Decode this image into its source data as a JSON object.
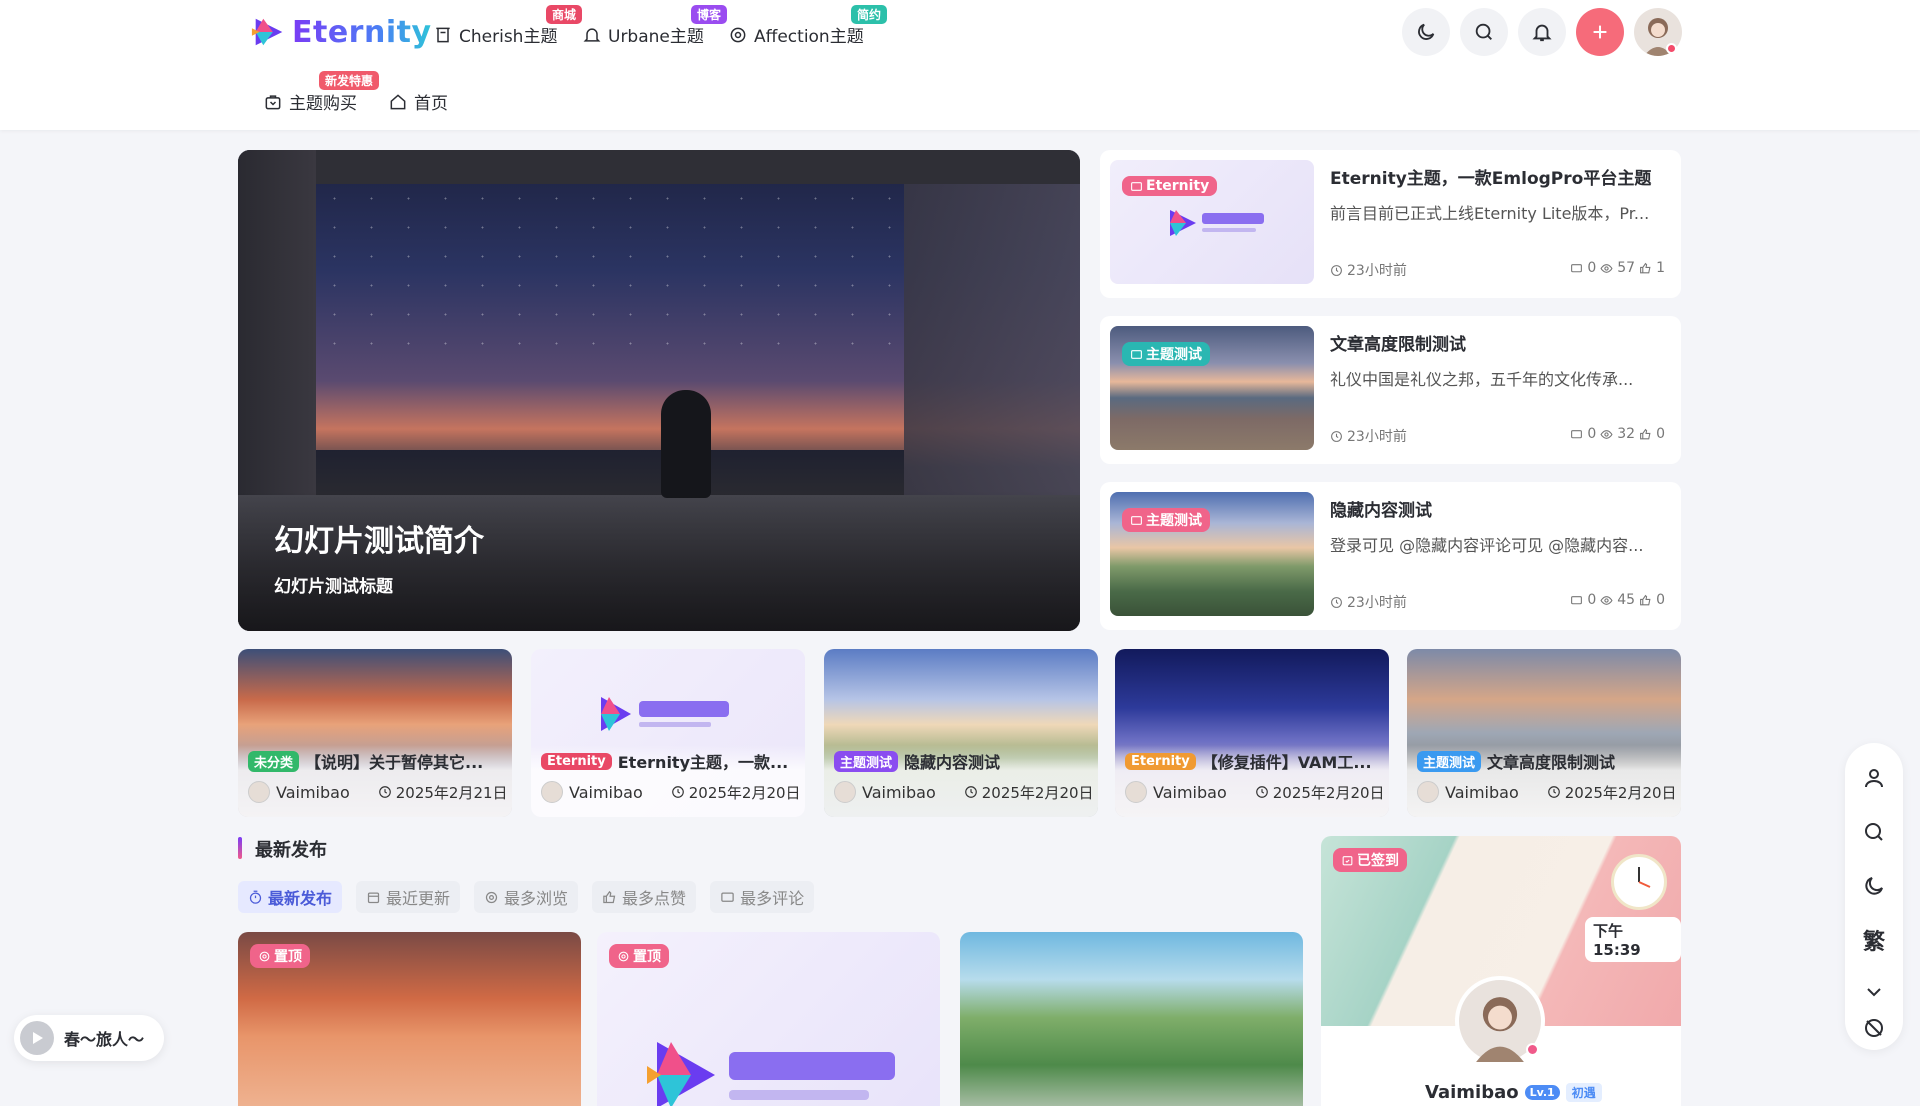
{
  "brand": {
    "name": "Eternity"
  },
  "nav": [
    {
      "label": "Cherish主题",
      "badge": "商城",
      "badge_color": "#e94866",
      "icon": "shop-icon"
    },
    {
      "label": "Urbane主题",
      "badge": "博客",
      "badge_color": "#9a4cf0",
      "icon": "bell-outline-icon"
    },
    {
      "label": "Affection主题",
      "badge": "简约",
      "badge_color": "#2cc0aa",
      "icon": "target-icon"
    },
    {
      "label": "主题购买",
      "badge": "新发特惠",
      "badge_color": "#f05a6b",
      "icon": "bag-icon"
    },
    {
      "label": "首页",
      "icon": "home-icon"
    }
  ],
  "header_actions": [
    "theme-toggle",
    "search",
    "notifications",
    "add",
    "user-avatar"
  ],
  "hero": {
    "title": "幻灯片测试简介",
    "subtitle": "幻灯片测试标题"
  },
  "side_posts": [
    {
      "tag": "Eternity",
      "tag_color": "#f0648a",
      "title": "Eternity主题，一款EmlogPro平台主题",
      "desc": "前言目前已正式上线Eternity Lite版本，Pr...",
      "time": "23小时前",
      "comments": "0",
      "views": "57",
      "likes": "1"
    },
    {
      "tag": "主题测试",
      "tag_color": "#2ab7b2",
      "title": "文章高度限制测试",
      "desc": "礼仪中国是礼仪之邦，五千年的文化传承...",
      "time": "23小时前",
      "comments": "0",
      "views": "32",
      "likes": "0"
    },
    {
      "tag": "主题测试",
      "tag_color": "#f0648a",
      "title": "隐藏内容测试",
      "desc": "登录可见 @隐藏内容评论可见 @隐藏内容...",
      "time": "23小时前",
      "comments": "0",
      "views": "45",
      "likes": "0"
    }
  ],
  "row_posts": [
    {
      "pill": "未分类",
      "pill_color": "#32b86a",
      "title": "【说明】关于暂停其它...",
      "author": "Vaimibao",
      "date": "2025年2月21日"
    },
    {
      "pill": "Eternity",
      "pill_color": "#e94866",
      "title": "Eternity主题，一款...",
      "author": "Vaimibao",
      "date": "2025年2月20日"
    },
    {
      "pill": "主题测试",
      "pill_color": "#8a4cf0",
      "title": "隐藏内容测试",
      "author": "Vaimibao",
      "date": "2025年2月20日"
    },
    {
      "pill": "Eternity",
      "pill_color": "#f09a32",
      "title": "【修复插件】VAM工...",
      "author": "Vaimibao",
      "date": "2025年2月20日"
    },
    {
      "pill": "主题测试",
      "pill_color": "#3a9af0",
      "title": "文章高度限制测试",
      "author": "Vaimibao",
      "date": "2025年2月20日"
    }
  ],
  "latest": {
    "title": "最新发布",
    "tabs": [
      "最新发布",
      "最近更新",
      "最多浏览",
      "最多点赞",
      "最多评论"
    ],
    "active_tab": "最新发布",
    "pinned_label": "置顶"
  },
  "sign_card": {
    "status": "已签到",
    "time": "下午 15:39",
    "user": "Vaimibao",
    "level": "Lv.1",
    "level_name": "初遇"
  },
  "float_bar": {
    "traditional_label": "繁"
  },
  "player": {
    "song": "春～旅人～"
  }
}
